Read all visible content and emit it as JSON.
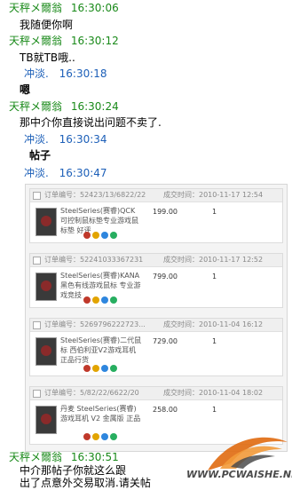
{
  "messages": [
    {
      "sender": "天秤メ爾翁",
      "time": "16:30:06",
      "text": "我随便你啊",
      "who": "other"
    },
    {
      "sender": "天秤メ爾翁",
      "time": "16:30:12",
      "text": "TB就TB哦..",
      "who": "other"
    },
    {
      "sender": "冲淡.",
      "time": "16:30:18",
      "text": "嗯",
      "who": "self"
    },
    {
      "sender": "天秤メ爾翁",
      "time": "16:30:24",
      "text": "那中介你直接说出问题不卖了.",
      "who": "other"
    },
    {
      "sender": "冲淡.",
      "time": "16:30:34",
      "text": "帖子",
      "who": "self"
    },
    {
      "sender": "冲淡.",
      "time": "16:30:47",
      "text": "",
      "who": "self"
    },
    {
      "sender": "天秤メ爾翁",
      "time": "16:30:51",
      "text": "中介那帖子你就这么跟",
      "text2": "出了点意外交易取消.请关帖",
      "who": "other"
    }
  ],
  "orders": [
    {
      "no_label": "订单编号：52423/13/6822/22",
      "time_label": "成交时间：2010-11-17 12:54",
      "name": "SteelSeries(赛睿)QCK可控制鼠标垫专业游戏鼠标垫 好评",
      "price": "199.00",
      "qty": "1"
    },
    {
      "no_label": "订单编号：52241033367231",
      "time_label": "成交时间：2010-11-17 12:52",
      "name": "SteelSeries(赛睿)KANA黑色有线游戏鼠标 专业游戏竞技",
      "price": "799.00",
      "qty": "1"
    },
    {
      "no_label": "订单编号：5269796222723...",
      "time_label": "成交时间：2010-11-04 16:12",
      "name": "SteelSeries(赛睿)二代鼠标 西伯利亚V2游戏耳机 正品行货",
      "price": "729.00",
      "qty": "1"
    },
    {
      "no_label": "订单编号：5/82/22/6622/20",
      "time_label": "成交时间：2010-11-04 18:02",
      "name": "丹麦 SteelSeries(赛睿) 游戏耳机 V2 金属版 正品",
      "price": "258.00",
      "qty": "1"
    }
  ],
  "watermark": "WWW.PCWAISHE.NET",
  "colors": {
    "other": "#1a8a1a",
    "self": "#1c5fb8"
  }
}
